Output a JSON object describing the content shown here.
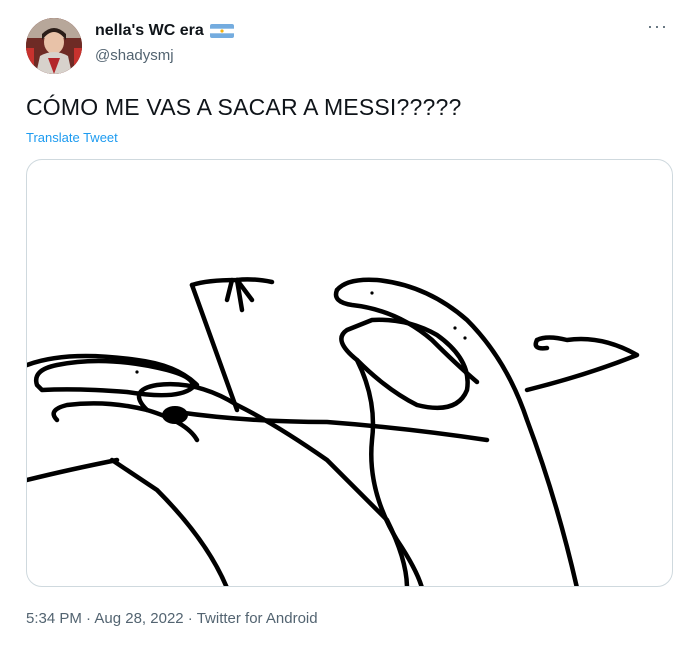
{
  "author": {
    "display_name": "nella's WC era",
    "handle": "@shadysmj",
    "flag_icon": "argentina-flag-icon",
    "avatar_icon": "user-avatar"
  },
  "tweet": {
    "text": "CÓMO ME VAS A SACAR A MESSI?????",
    "translate_label": "Translate Tweet",
    "more_icon": "more-options-icon"
  },
  "media": {
    "type": "image",
    "description_icon": "hand-drawn-sketch-image"
  },
  "meta": {
    "time": "5:34 PM",
    "separator": " · ",
    "date": "Aug 28, 2022",
    "source": "Twitter for Android"
  },
  "colors": {
    "link": "#1d9bf0",
    "secondary_text": "#536471",
    "border": "#cfd9de",
    "flag_blue": "#74acdf"
  }
}
